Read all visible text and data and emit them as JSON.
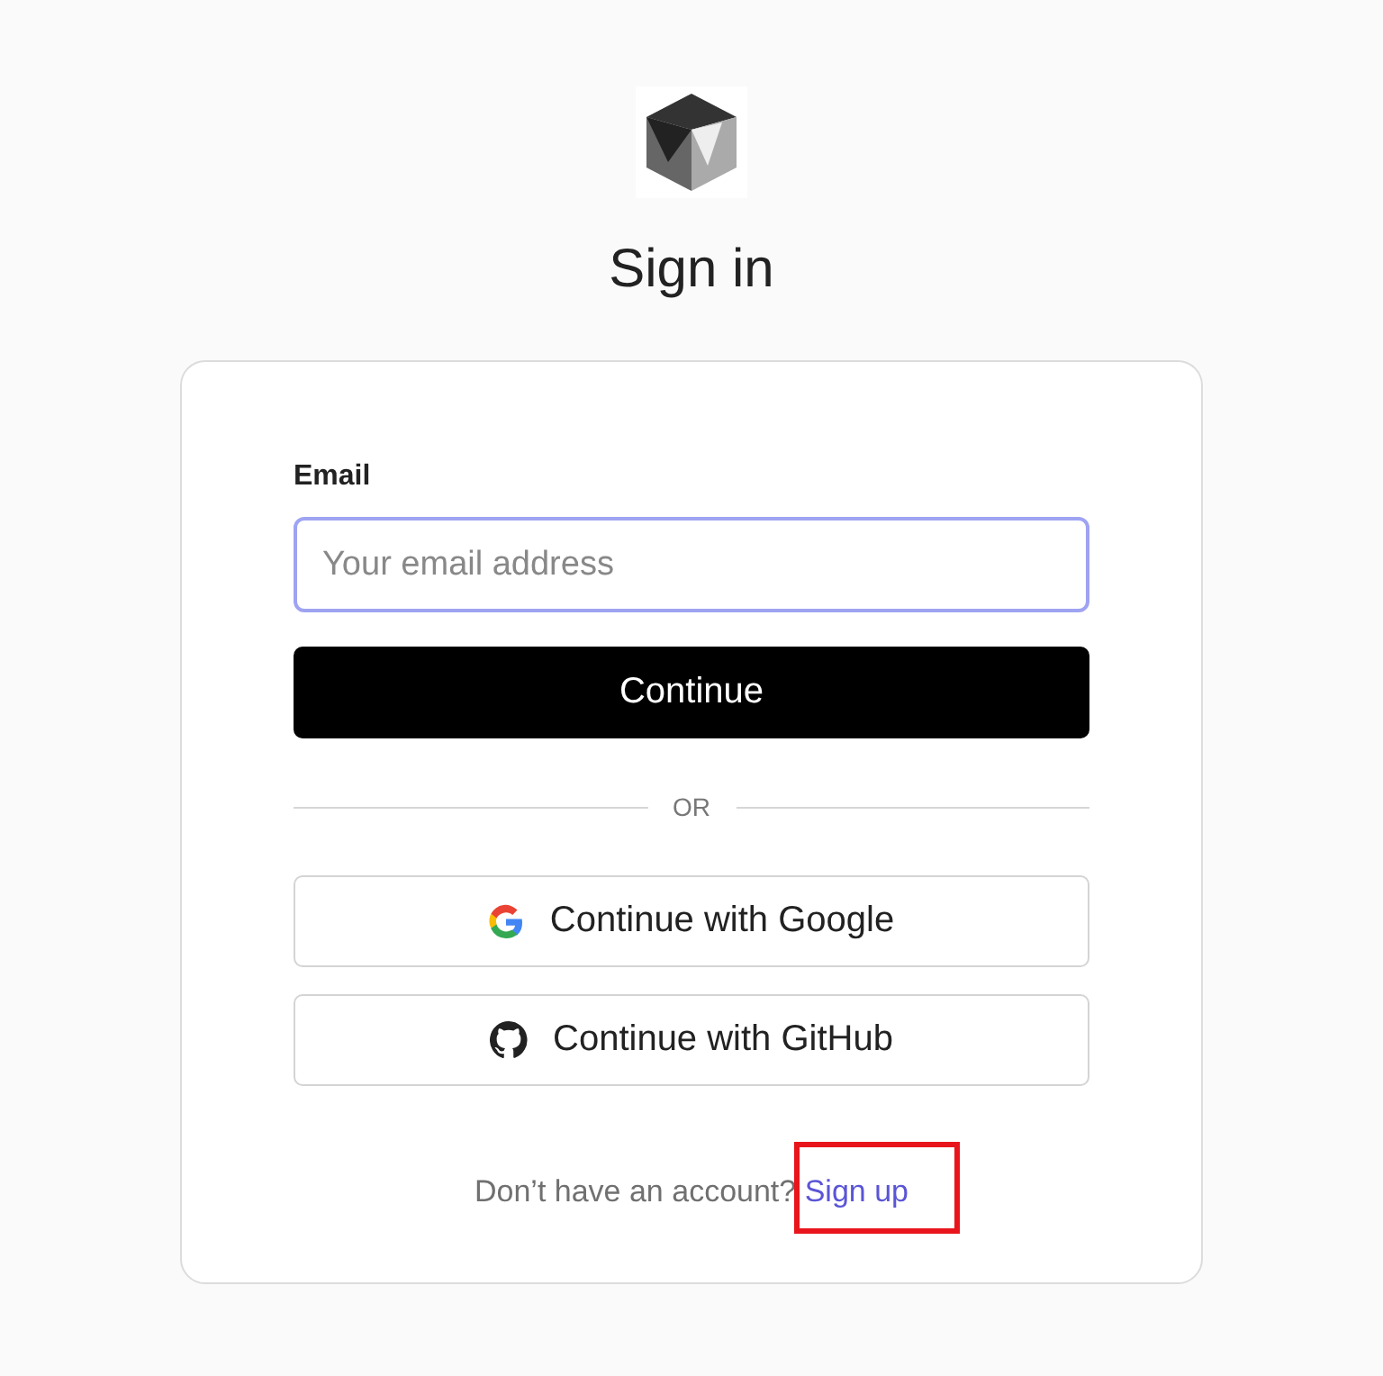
{
  "title": "Sign in",
  "form": {
    "label": "Email",
    "placeholder": "Your email address",
    "submit": "Continue",
    "focused": true
  },
  "divider": "OR",
  "providers": [
    {
      "kind": "google",
      "label": "Continue with Google"
    },
    {
      "kind": "github",
      "label": "Continue with GitHub"
    }
  ],
  "footer": {
    "text": "Don’t have an account?",
    "link": "Sign up",
    "highlighted": true
  }
}
